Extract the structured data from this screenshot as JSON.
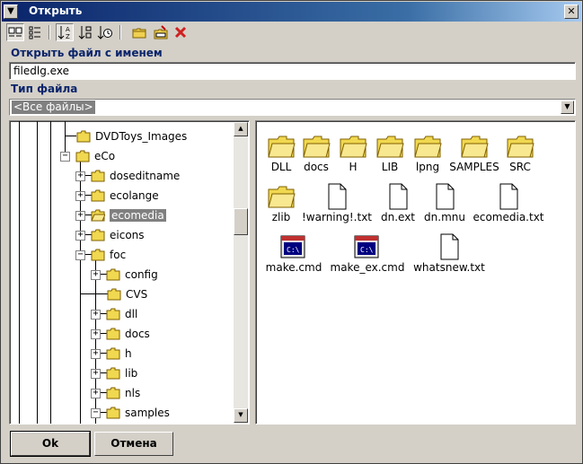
{
  "window": {
    "title": "Открыть",
    "close_glyph": "✕",
    "sys_glyph": "▼"
  },
  "toolbar": {
    "buttons": [
      "large-icons",
      "details",
      "sort-by-name",
      "sort-by-size",
      "sort-by-date",
      "new-folder",
      "rename",
      "delete"
    ]
  },
  "filename": {
    "label": "Открыть файл с именем",
    "value": "filedlg.exe"
  },
  "filetype": {
    "label": "Тип файла",
    "value": "<Все файлы>"
  },
  "tree": {
    "items": [
      {
        "label": "DVDToys_Images",
        "expander": ""
      },
      {
        "label": "eCo",
        "expander": "−"
      },
      {
        "label": "doseditname",
        "expander": "+"
      },
      {
        "label": "ecolange",
        "expander": "+"
      },
      {
        "label": "ecomedia",
        "expander": "+",
        "selected": true
      },
      {
        "label": "eicons",
        "expander": "+"
      },
      {
        "label": "foc",
        "expander": "−"
      },
      {
        "label": "config",
        "expander": "+"
      },
      {
        "label": "CVS",
        "expander": ""
      },
      {
        "label": "dll",
        "expander": "+"
      },
      {
        "label": "docs",
        "expander": "+"
      },
      {
        "label": "h",
        "expander": "+"
      },
      {
        "label": "lib",
        "expander": "+"
      },
      {
        "label": "nls",
        "expander": "+"
      },
      {
        "label": "samples",
        "expander": "−"
      }
    ]
  },
  "files": {
    "items": [
      {
        "name": "DLL",
        "icon": "folder-icon"
      },
      {
        "name": "docs",
        "icon": "folder-icon"
      },
      {
        "name": "H",
        "icon": "folder-icon"
      },
      {
        "name": "LIB",
        "icon": "folder-icon"
      },
      {
        "name": "lpng",
        "icon": "folder-icon"
      },
      {
        "name": "SAMPLES",
        "icon": "folder-icon"
      },
      {
        "name": "SRC",
        "icon": "folder-icon"
      },
      {
        "name": "zlib",
        "icon": "folder-icon"
      },
      {
        "name": "!warning!.txt",
        "icon": "document-icon"
      },
      {
        "name": "dn.ext",
        "icon": "document-icon"
      },
      {
        "name": "dn.mnu",
        "icon": "document-icon"
      },
      {
        "name": "ecomedia.txt",
        "icon": "document-icon"
      },
      {
        "name": "make.cmd",
        "icon": "command-script-icon",
        "icon_text": "C:\\"
      },
      {
        "name": "make_ex.cmd",
        "icon": "command-script-icon",
        "icon_text": "C:\\"
      },
      {
        "name": "whatsnew.txt",
        "icon": "document-icon"
      }
    ]
  },
  "buttons": {
    "ok": "Ok",
    "cancel": "Отмена"
  },
  "colors": {
    "title_start": "#0a246a",
    "title_end": "#a6caf0",
    "label": "#0a246a",
    "selection": "#808080",
    "face": "#d4d0c8"
  }
}
